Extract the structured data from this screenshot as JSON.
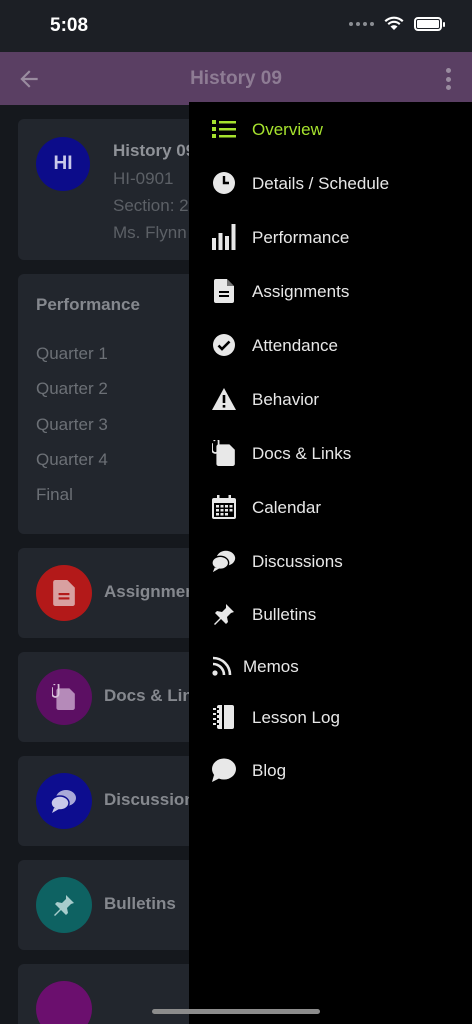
{
  "status_bar": {
    "time": "5:08"
  },
  "app_bar": {
    "title": "History 09"
  },
  "course": {
    "avatar_initials": "HI",
    "avatar_color": "#0c0c8a",
    "name": "History 09",
    "code": "HI-0901",
    "section": "Section: 2",
    "teacher": "Ms. Flynn"
  },
  "performance": {
    "title": "Performance",
    "rows": [
      "Quarter 1",
      "Quarter 2",
      "Quarter 3",
      "Quarter 4",
      "Final"
    ]
  },
  "features": [
    {
      "label": "Assignments",
      "icon": "document-icon",
      "color": "#b31919"
    },
    {
      "label": "Docs & Links",
      "icon": "docs-icon",
      "color": "#5c0f63"
    },
    {
      "label": "Discussions",
      "icon": "chat-bubbles-icon",
      "color": "#0d0d8f"
    },
    {
      "label": "Bulletins",
      "icon": "pin-icon",
      "color": "#0e6262"
    }
  ],
  "drawer": {
    "accent_color": "#a6e22e",
    "items": [
      {
        "label": "Overview",
        "icon": "list-icon",
        "active": true
      },
      {
        "label": "Details / Schedule",
        "icon": "clock-icon"
      },
      {
        "label": "Performance",
        "icon": "bar-chart-icon"
      },
      {
        "label": "Assignments",
        "icon": "document-icon"
      },
      {
        "label": "Attendance",
        "icon": "check-circle-icon"
      },
      {
        "label": "Behavior",
        "icon": "warning-icon"
      },
      {
        "label": "Docs & Links",
        "icon": "docs-icon"
      },
      {
        "label": "Calendar",
        "icon": "calendar-icon"
      },
      {
        "label": "Discussions",
        "icon": "chat-bubbles-icon"
      },
      {
        "label": "Bulletins",
        "icon": "pin-icon"
      },
      {
        "label": "Memos",
        "icon": "rss-icon"
      },
      {
        "label": "Lesson Log",
        "icon": "notebook-icon"
      },
      {
        "label": "Blog",
        "icon": "speech-bubble-icon"
      }
    ]
  }
}
